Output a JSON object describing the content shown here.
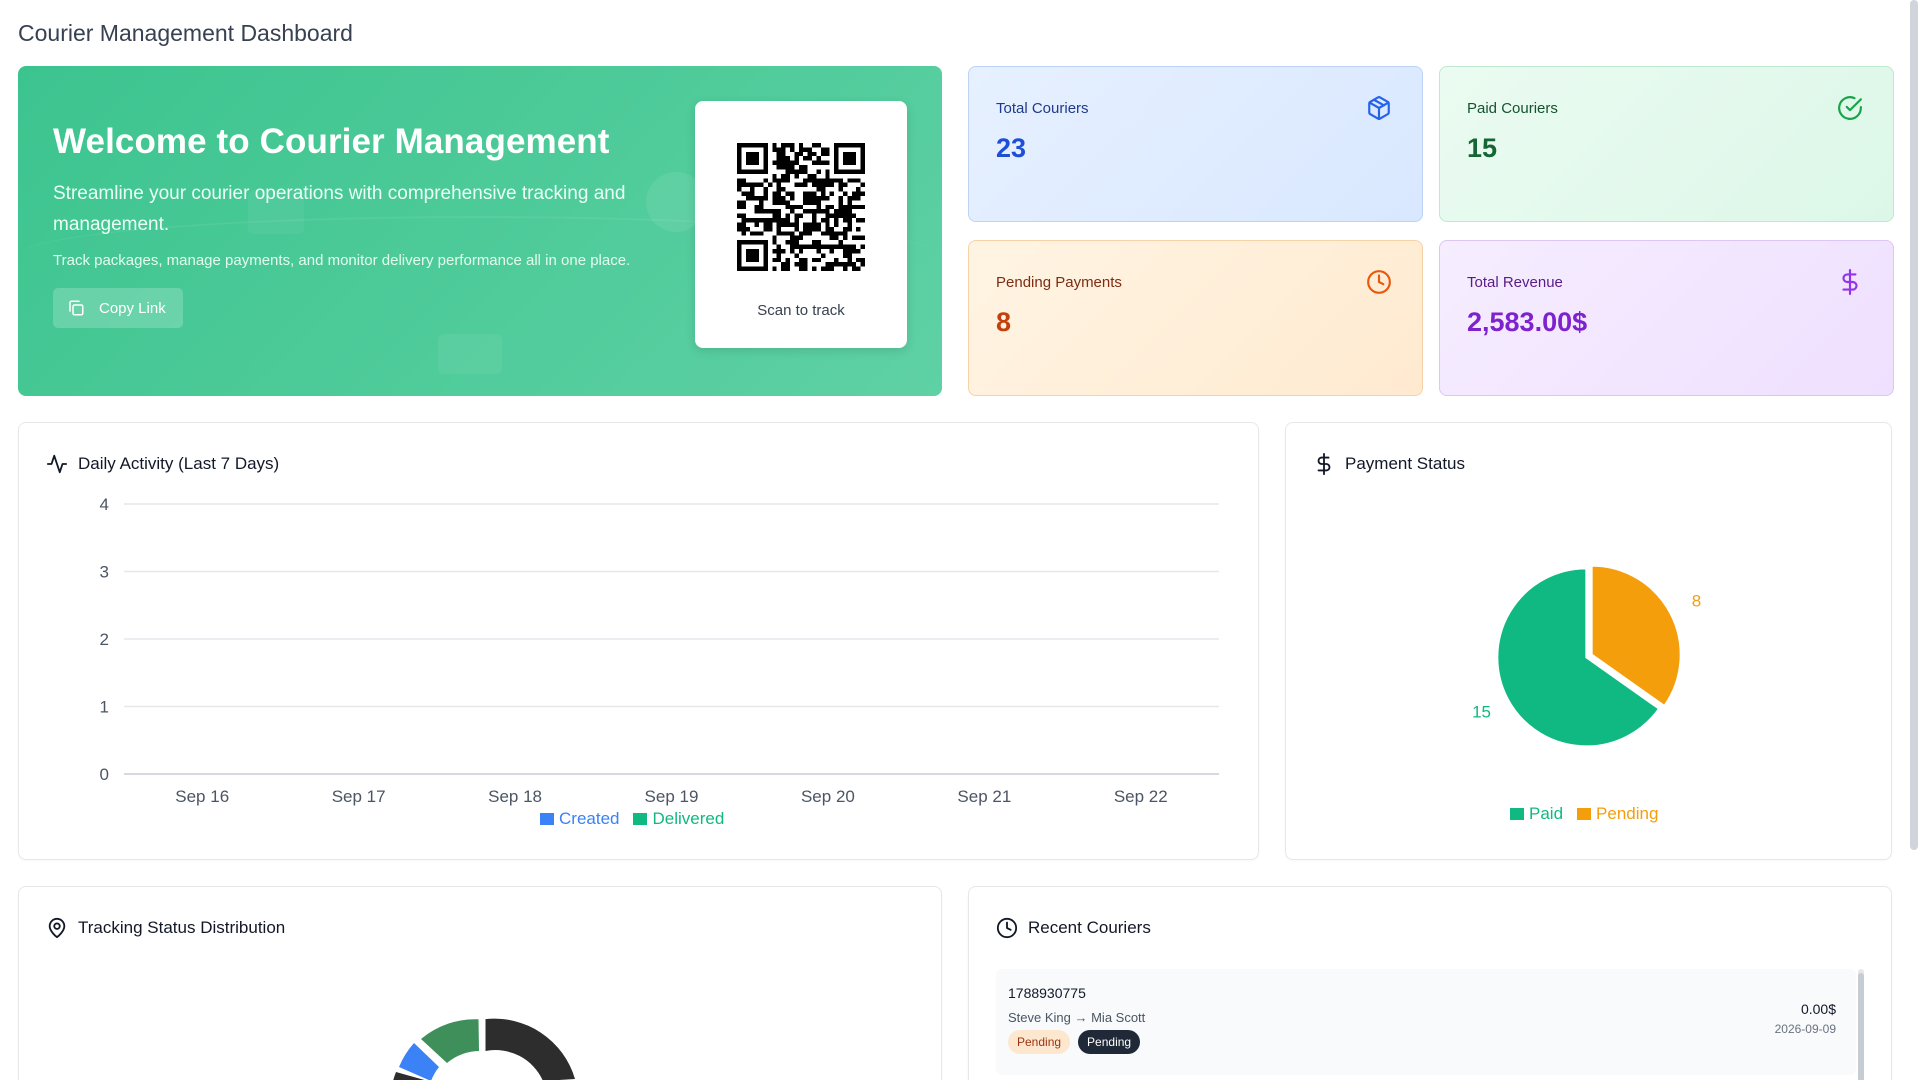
{
  "page_title": "Courier Management Dashboard",
  "hero": {
    "title": "Welcome to Courier Management",
    "subtitle": "Streamline your courier operations with comprehensive tracking and management.",
    "description": "Track packages, manage payments, and monitor delivery performance all in one place.",
    "copy_button": "Copy Link",
    "qr_label": "Scan to track"
  },
  "stats": {
    "total_couriers": {
      "label": "Total Couriers",
      "value": "23",
      "icon": "package-icon"
    },
    "paid_couriers": {
      "label": "Paid Couriers",
      "value": "15",
      "icon": "check-circle-icon"
    },
    "pending_payments": {
      "label": "Pending Payments",
      "value": "8",
      "icon": "clock-icon"
    },
    "total_revenue": {
      "label": "Total Revenue",
      "value": "2,583.00$",
      "icon": "dollar-icon"
    }
  },
  "daily": {
    "title": "Daily Activity (Last 7 Days)",
    "legend": [
      "Created",
      "Delivered"
    ]
  },
  "payment": {
    "title": "Payment Status",
    "legend": [
      "Paid",
      "Pending"
    ]
  },
  "tracking": {
    "title": "Tracking Status Distribution"
  },
  "recent": {
    "title": "Recent Couriers",
    "items": [
      {
        "id": "1788930775",
        "route": "Steve King → Mia Scott",
        "badge1": "Pending",
        "badge2": "Pending",
        "amount": "0.00$",
        "date": "2026-09-09"
      }
    ]
  },
  "colors": {
    "created": "#3b82f6",
    "delivered": "#10b981",
    "paid": "#10b981",
    "pending": "#f59e0b",
    "donut_dark": "#2d2d2d",
    "donut_green": "#3f8f5a",
    "donut_blue": "#3b82f6"
  },
  "chart_data": [
    {
      "type": "bar",
      "categories": [
        "Sep 16",
        "Sep 17",
        "Sep 18",
        "Sep 19",
        "Sep 20",
        "Sep 21",
        "Sep 22"
      ],
      "series": [
        {
          "name": "Created",
          "values": [
            0,
            0,
            0,
            0,
            0,
            0,
            0
          ]
        },
        {
          "name": "Delivered",
          "values": [
            0,
            0,
            0,
            0,
            0,
            0,
            0
          ]
        }
      ],
      "yticks": [
        0,
        1,
        2,
        3,
        4
      ],
      "ylim": [
        0,
        4
      ],
      "grid": true,
      "legend": "bottom"
    },
    {
      "type": "pie",
      "labels": [
        "Paid",
        "Pending"
      ],
      "values": [
        15,
        8
      ],
      "legend": "bottom"
    }
  ]
}
